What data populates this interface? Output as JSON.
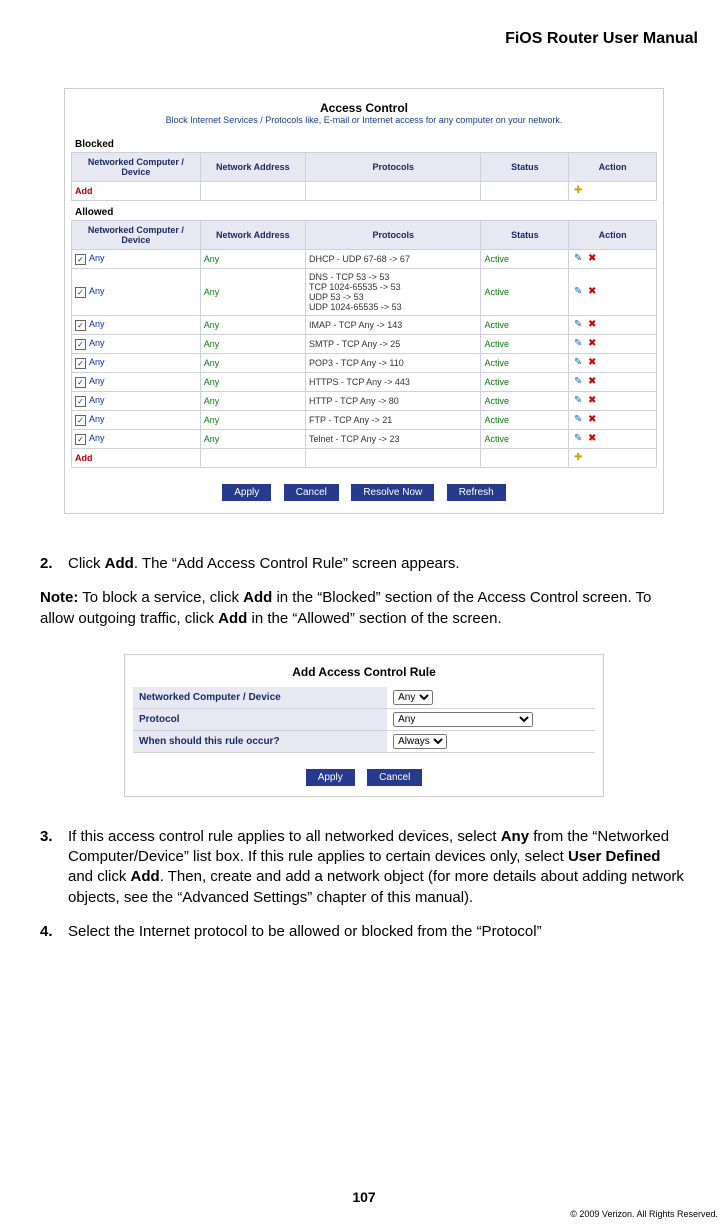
{
  "header": {
    "title": "FiOS Router User Manual"
  },
  "access_control": {
    "title": "Access Control",
    "subtitle": "Block Internet Services / Protocols like, E-mail or Internet access for any computer on your network.",
    "blocked_label": "Blocked",
    "allowed_label": "Allowed",
    "columns": {
      "device": "Networked Computer / Device",
      "address": "Network Address",
      "protocols": "Protocols",
      "status": "Status",
      "action": "Action"
    },
    "add_label": "Add",
    "allowed_rows": [
      {
        "device": "Any",
        "address": "Any",
        "protocols": "DHCP - UDP 67-68 -> 67",
        "status": "Active"
      },
      {
        "device": "Any",
        "address": "Any",
        "protocols": "DNS - TCP 53 -> 53\n    TCP 1024-65535 -> 53\n    UDP 53 -> 53\n    UDP 1024-65535 -> 53",
        "status": "Active"
      },
      {
        "device": "Any",
        "address": "Any",
        "protocols": "IMAP - TCP Any -> 143",
        "status": "Active"
      },
      {
        "device": "Any",
        "address": "Any",
        "protocols": "SMTP - TCP Any -> 25",
        "status": "Active"
      },
      {
        "device": "Any",
        "address": "Any",
        "protocols": "POP3 - TCP Any -> 110",
        "status": "Active"
      },
      {
        "device": "Any",
        "address": "Any",
        "protocols": "HTTPS - TCP Any -> 443",
        "status": "Active"
      },
      {
        "device": "Any",
        "address": "Any",
        "protocols": "HTTP - TCP Any -> 80",
        "status": "Active"
      },
      {
        "device": "Any",
        "address": "Any",
        "protocols": "FTP - TCP Any -> 21",
        "status": "Active"
      },
      {
        "device": "Any",
        "address": "Any",
        "protocols": "Telnet - TCP Any -> 23",
        "status": "Active"
      }
    ],
    "buttons": {
      "apply": "Apply",
      "cancel": "Cancel",
      "resolve": "Resolve Now",
      "refresh": "Refresh"
    }
  },
  "add_rule": {
    "title": "Add Access Control Rule",
    "fields": {
      "device": "Networked Computer / Device",
      "protocol": "Protocol",
      "when": "When should this rule occur?"
    },
    "values": {
      "device": "Any",
      "protocol": "Any",
      "when": "Always"
    },
    "buttons": {
      "apply": "Apply",
      "cancel": "Cancel"
    }
  },
  "steps": {
    "s2_num": "2.",
    "s2_a": "Click ",
    "s2_b": "Add",
    "s2_c": ". The “Add Access Control Rule” screen appears.",
    "note_a": "Note:",
    "note_b": " To block a service, click ",
    "note_c": "Add",
    "note_d": " in the “Blocked” section of the Access Control screen. To allow outgoing traffic, click ",
    "note_e": "Add",
    "note_f": " in the “Allowed” section of the screen.",
    "s3_num": "3.",
    "s3_a": "If this access control rule applies to all networked devices, select ",
    "s3_b": "Any",
    "s3_c": " from the “Networked Computer/Device” list box. If this rule applies to certain devices only, select ",
    "s3_d": "User Defined",
    "s3_e": " and click ",
    "s3_f": "Add",
    "s3_g": ". Then, create and add a network object (for more details about adding network objects, see the “Advanced Settings” chapter of this manual).",
    "s4_num": "4.",
    "s4": "Select the Internet protocol to be allowed or blocked from the “Protocol”"
  },
  "footer": {
    "page_num": "107",
    "copyright": "© 2009 Verizon. All Rights Reserved."
  }
}
